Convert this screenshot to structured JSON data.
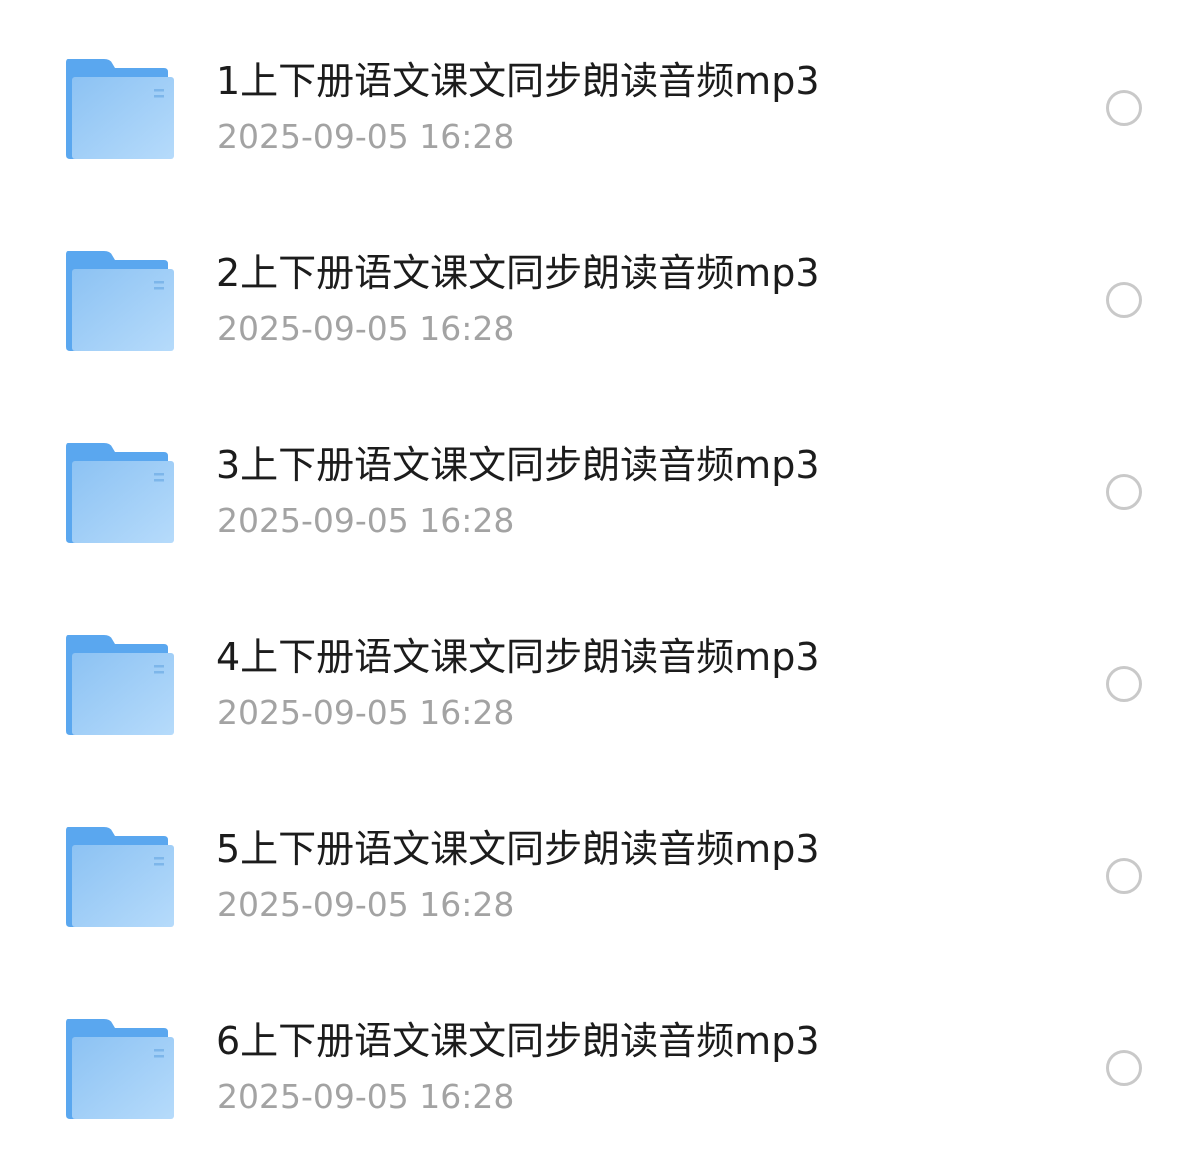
{
  "files": [
    {
      "name": "1上下册语文课文同步朗读音频mp3",
      "date": "2025-09-05 16:28",
      "icon": "folder-icon"
    },
    {
      "name": "2上下册语文课文同步朗读音频mp3",
      "date": "2025-09-05 16:28",
      "icon": "folder-icon"
    },
    {
      "name": "3上下册语文课文同步朗读音频mp3",
      "date": "2025-09-05 16:28",
      "icon": "folder-icon"
    },
    {
      "name": "4上下册语文课文同步朗读音频mp3",
      "date": "2025-09-05 16:28",
      "icon": "folder-icon"
    },
    {
      "name": "5上下册语文课文同步朗读音频mp3",
      "date": "2025-09-05 16:28",
      "icon": "folder-icon"
    },
    {
      "name": "6上下册语文课文同步朗读音频mp3",
      "date": "2025-09-05 16:28",
      "icon": "folder-icon"
    }
  ],
  "colors": {
    "folder_back": "#5aa7ef",
    "folder_front_top": "#8fc4f4",
    "folder_front_bottom": "#b2d9fa",
    "name_text": "#1c1c1c",
    "date_text": "#a3a3a3",
    "radio_border": "#c9c9c9"
  }
}
